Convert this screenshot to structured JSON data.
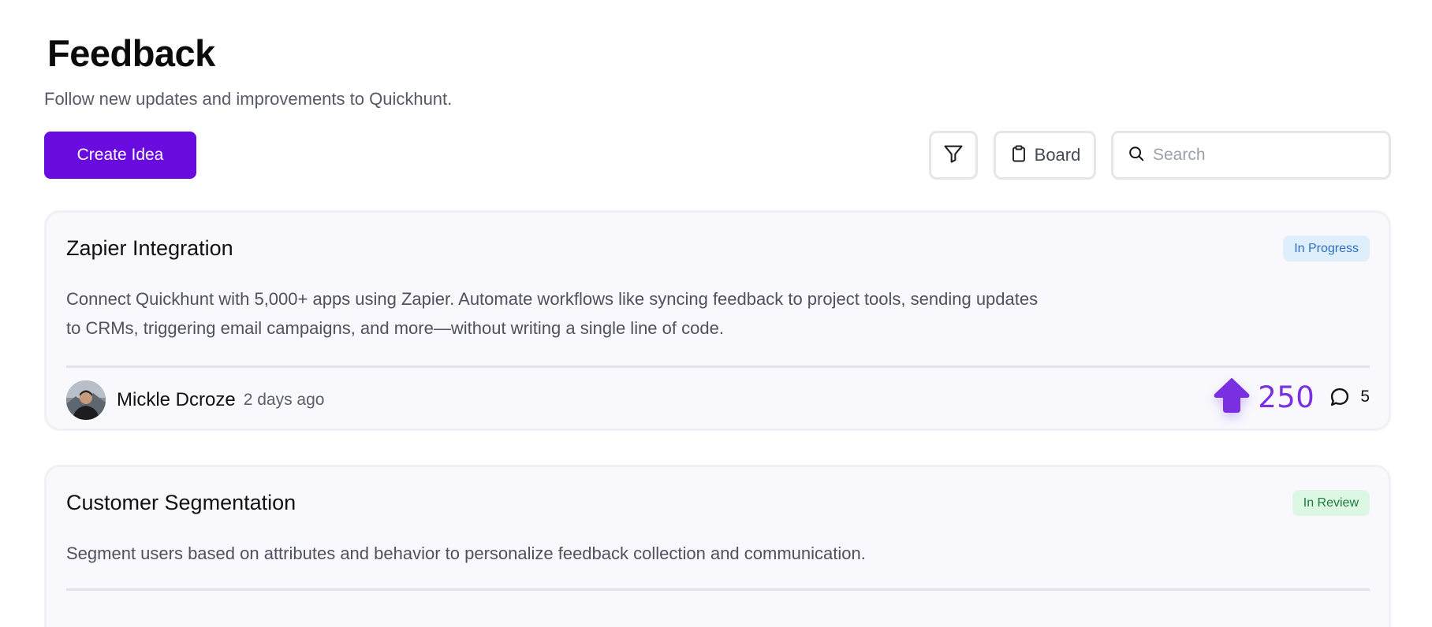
{
  "header": {
    "title": "Feedback",
    "subtitle": "Follow new updates and improvements to Quickhunt."
  },
  "toolbar": {
    "create_label": "Create Idea",
    "filter_icon": "filter-icon",
    "board_label": "Board",
    "board_icon": "clipboard-icon",
    "search_placeholder": "Search",
    "search_value": "",
    "search_icon": "search-icon"
  },
  "colors": {
    "accent": "#6a0be0",
    "vote": "#7a2fe0",
    "in_progress_bg": "#dfeefb",
    "in_progress_text": "#2f6fc2",
    "in_review_bg": "#dcf8e4",
    "in_review_text": "#1f7a3d",
    "card_bg": "#f8f8fd"
  },
  "ideas": [
    {
      "title": "Zapier Integration",
      "status": "In Progress",
      "description_lines": [
        "Connect Quickhunt with 5,000+ apps using Zapier. Automate workflows like syncing feedback to project tools, sending updates",
        "to CRMs, triggering email campaigns, and more—without writing a single line of code."
      ],
      "author": "Mickle Dcroze",
      "time_ago": "2 days ago",
      "votes": "250",
      "comments": "5"
    },
    {
      "title": "Customer Segmentation",
      "status": "In Review",
      "description_lines": [
        "Segment users based on attributes and behavior to personalize feedback collection and communication."
      ]
    }
  ]
}
